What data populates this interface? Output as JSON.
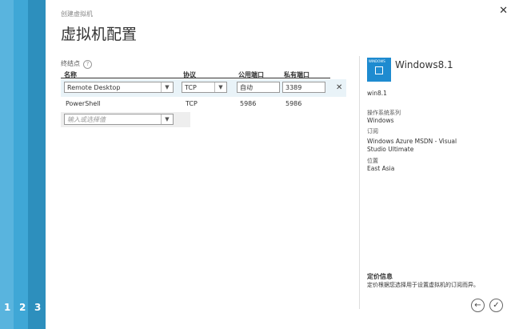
{
  "steps": [
    "1",
    "2",
    "3"
  ],
  "header": {
    "breadcrumb": "创建虚拟机",
    "title": "虚拟机配置",
    "close": "✕"
  },
  "endpoints": {
    "section_label": "终结点",
    "help": "?",
    "columns": {
      "name": "名称",
      "protocol": "协议",
      "public_port": "公用端口",
      "private_port": "私有端口"
    },
    "rows": [
      {
        "name": "Remote Desktop",
        "protocol": "TCP",
        "public_port": "自动",
        "private_port": "3389"
      },
      {
        "name": "PowerShell",
        "protocol": "TCP",
        "public_port": "5986",
        "private_port": "5986"
      }
    ],
    "new_placeholder": "输入或选择值",
    "delete": "✕"
  },
  "side": {
    "logo_text": "WINDOWS",
    "product_name": "Windows8.1",
    "vm_name": "win8.1",
    "os_label": "操作系统系列",
    "os_value": "Windows",
    "subscription_label": "订阅",
    "subscription_value_1": "Windows Azure MSDN - Visual",
    "subscription_value_2": "Studio Ultimate",
    "location_label": "位置",
    "location_value": "East Asia",
    "pricing_title": "定价信息",
    "pricing_desc": "定价根据您选择用于设置虚拟机的订阅而异。"
  },
  "nav": {
    "back": "←",
    "finish": "✓"
  }
}
